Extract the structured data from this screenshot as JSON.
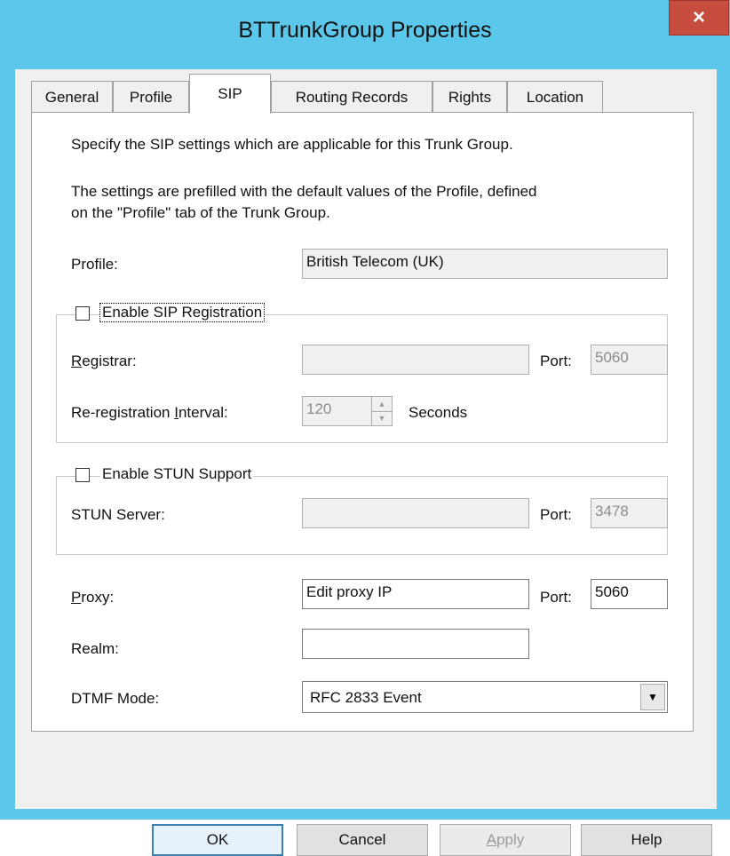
{
  "window": {
    "title": "BTTrunkGroup Properties",
    "close_glyph": "×"
  },
  "tabs": [
    {
      "label": "General"
    },
    {
      "label": "Profile"
    },
    {
      "label": "SIP"
    },
    {
      "label": "Routing Records"
    },
    {
      "label": "Rights"
    },
    {
      "label": "Location"
    }
  ],
  "active_tab": "SIP",
  "intro": {
    "line1": "Specify the SIP settings which are applicable for this Trunk Group.",
    "line2a": "The settings are prefilled with the default values of the Profile, defined",
    "line2b": "on the \"Profile\" tab of the Trunk Group."
  },
  "profile": {
    "label": "Profile:",
    "value": "British Telecom (UK)"
  },
  "sip_registration": {
    "checkbox_label": "Enable SIP Registration",
    "checked": false,
    "registrar_label_first": "R",
    "registrar_label_rest": "egistrar:",
    "registrar_value": "",
    "port_label": "Port:",
    "port_value": "5060",
    "interval_label_a": "Re-registration ",
    "interval_label_u": "I",
    "interval_label_b": "nterval:",
    "interval_value": "120",
    "seconds_label": "Seconds"
  },
  "stun": {
    "checkbox_label": "Enable STUN Support",
    "checked": false,
    "server_label": "STUN Server:",
    "server_value": "",
    "port_label": "Port:",
    "port_value": "3478"
  },
  "proxy": {
    "label_first": "P",
    "label_rest": "roxy:",
    "value": "Edit proxy IP",
    "port_label": "Port:",
    "port_value": "5060"
  },
  "realm": {
    "label": "Realm:",
    "value": ""
  },
  "dtmf": {
    "label": "DTMF Mode:",
    "value": "RFC 2833 Event",
    "arrow_glyph": "▼"
  },
  "buttons": {
    "ok": "OK",
    "cancel": "Cancel",
    "apply_first": "A",
    "apply_rest": "pply",
    "help": "Help"
  },
  "colors": {
    "titlebar": "#5bc7ea",
    "close": "#c74d3f",
    "default_button_border": "#3c7fb1"
  }
}
